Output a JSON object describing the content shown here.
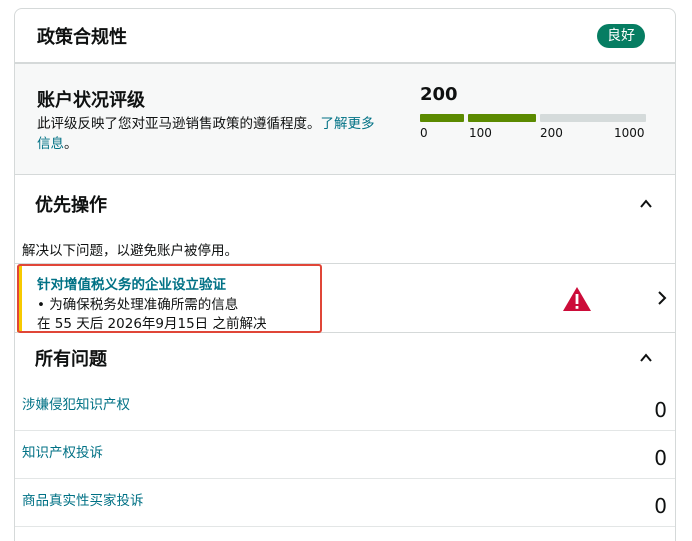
{
  "header": {
    "title": "政策合规性",
    "badge": "良好"
  },
  "account": {
    "title": "账户状况评级",
    "description": "此评级反映了您对亚马逊销售政策的遵循程度。",
    "link_text": "了解更多信息",
    "period": "。",
    "score": "200",
    "ticks": [
      "0",
      "100",
      "200",
      "1000"
    ],
    "colors": {
      "filled": "#5b8a00",
      "empty": "#d5dbdb"
    }
  },
  "priority": {
    "title": "优先操作",
    "note": "解决以下问题，以避免账户被停用。",
    "item": {
      "title": "针对增值税义务的企业设立验证",
      "line": "• 为确保税务处理准确所需的信息",
      "due": "在 55 天后 2026年9月15日 之前解决"
    }
  },
  "issues": {
    "title": "所有问题",
    "items": [
      {
        "label": "涉嫌侵犯知识产权",
        "count": "0"
      },
      {
        "label": "知识产权投诉",
        "count": "0"
      },
      {
        "label": "商品真实性买家投诉",
        "count": "0"
      }
    ]
  }
}
